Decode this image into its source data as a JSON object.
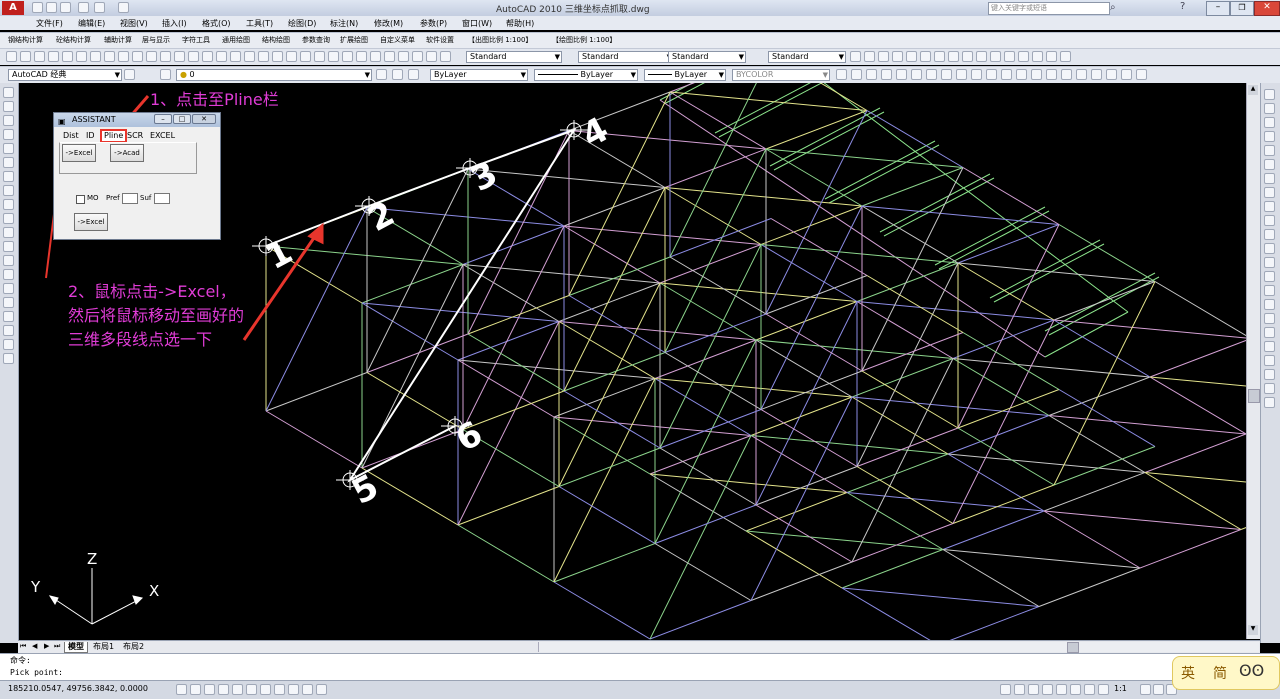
{
  "title_bar": {
    "title": "AutoCAD 2010    三维坐标点抓取.dwg",
    "search_placeholder": "键入关键字或短语",
    "window_controls": [
      "minimize-icon",
      "restore-icon",
      "close-icon"
    ]
  },
  "menu": [
    "文件(F)",
    "编辑(E)",
    "视图(V)",
    "插入(I)",
    "格式(O)",
    "工具(T)",
    "绘图(D)",
    "标注(N)",
    "修改(M)",
    "参数(P)",
    "窗口(W)",
    "帮助(H)"
  ],
  "custom_menu": [
    "钢结构计算",
    "砼结构计算",
    "辅助计算",
    "层与显示",
    "字符工具",
    "通用绘图",
    "结构绘图",
    "参数查询",
    "扩展绘图",
    "自定义菜单",
    "软件设置",
    "【出图比例 1:100】",
    "【绘图比例 1:100】"
  ],
  "toolbar": {
    "text_style": "Standard",
    "dim_style": "Standard",
    "table_style": "Standard",
    "multileader_style": "Standard"
  },
  "layer_bar": {
    "workspace": "AutoCAD 经典",
    "layer": "0",
    "color": "ByLayer",
    "linetype": "ByLayer",
    "lineweight": "ByLayer",
    "plotstyle": "BYCOLOR"
  },
  "dialog": {
    "title": "ASSISTANT",
    "tabs": [
      "Dist",
      "ID",
      "Pline",
      "SCR",
      "EXCEL"
    ],
    "active_tab": "Pline",
    "button_excel": "->Excel",
    "button_acad": "->Acad",
    "checkbox_label": "MO",
    "pref_label": "Pref",
    "suf_label": "Suf",
    "button_excel2": "->Excel"
  },
  "annotations": {
    "step1": "1、点击至Pline栏",
    "step2_line1": "2、鼠标点击->Excel，",
    "step2_line2": "然后将鼠标移动至画好的",
    "step2_line3": "三维多段线点选一下"
  },
  "point_labels": [
    "1",
    "2",
    "3",
    "4",
    "5",
    "6"
  ],
  "ucs": {
    "x": "X",
    "y": "Y",
    "z": "Z"
  },
  "layout_tabs": [
    "模型",
    "布局1",
    "布局2"
  ],
  "active_layout": "模型",
  "command": {
    "line1": "命令:",
    "line2": "Pick point:"
  },
  "status": {
    "coords": "185210.0547,  49756.3842,  0.0000",
    "annotation_scale": "1:1"
  },
  "ime": {
    "lang": "英",
    "mode": "简"
  },
  "colors": {
    "annotation": "#e03cd6",
    "arrow": "#e8352c",
    "canvas": "#000000"
  }
}
